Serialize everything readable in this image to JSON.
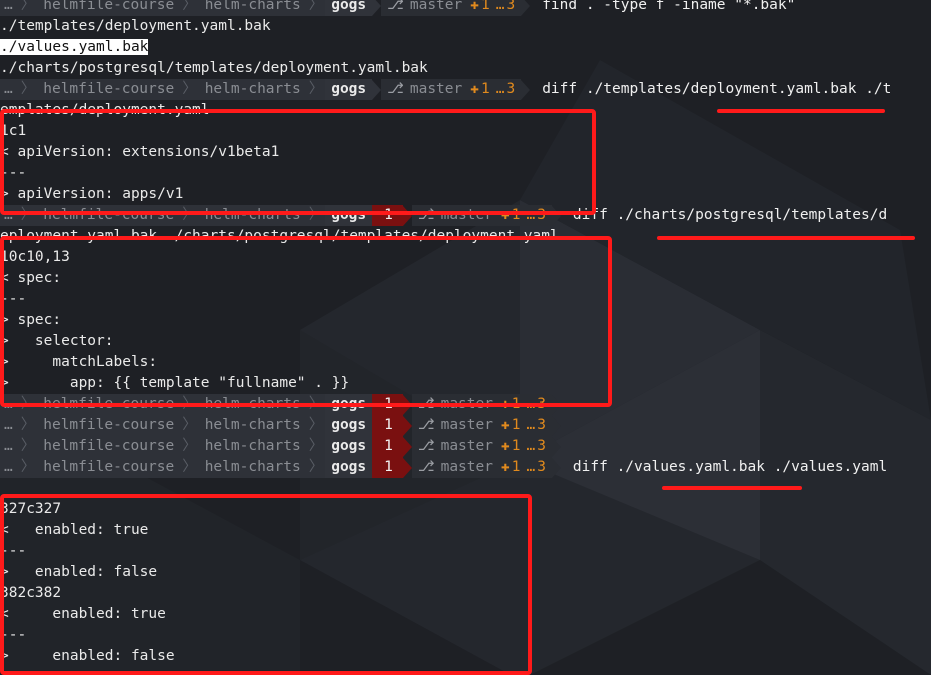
{
  "prompt": {
    "ellipsis": "…",
    "dir1": "helmfile-course",
    "dir2": "helm-charts",
    "dir3": "gogs",
    "branch_icon": "git-branch-icon",
    "branch": "master",
    "plus": "✚",
    "added": "1",
    "more": "…",
    "untracked": "3",
    "exit_code": "1"
  },
  "lines": [
    {
      "type": "prompt",
      "cmd": "find . -type f -iname \"*.bak\""
    },
    {
      "type": "out",
      "text": "./templates/deployment.yaml.bak"
    },
    {
      "type": "out_hl",
      "text": "./values.yaml.bak"
    },
    {
      "type": "out",
      "text": "./charts/postgresql/templates/deployment.yaml.bak"
    },
    {
      "type": "prompt",
      "cmd": "diff ./templates/deployment.yaml.bak ./t"
    },
    {
      "type": "out",
      "text": "emplates/deployment.yaml"
    },
    {
      "type": "out",
      "text": "1c1"
    },
    {
      "type": "out",
      "text": "< apiVersion: extensions/v1beta1"
    },
    {
      "type": "out",
      "text": "---"
    },
    {
      "type": "out",
      "text": "> apiVersion: apps/v1"
    },
    {
      "type": "prompt_err",
      "cmd": "diff ./charts/postgresql/templates/d"
    },
    {
      "type": "out",
      "text": "eployment.yaml.bak ./charts/postgresql/templates/deployment.yaml"
    },
    {
      "type": "out",
      "text": "10c10,13"
    },
    {
      "type": "out",
      "text": "< spec:"
    },
    {
      "type": "out",
      "text": "---"
    },
    {
      "type": "out",
      "text": "> spec:"
    },
    {
      "type": "out",
      "text": ">   selector:"
    },
    {
      "type": "out",
      "text": ">     matchLabels:"
    },
    {
      "type": "out",
      "text": ">       app: {{ template \"fullname\" . }}"
    },
    {
      "type": "prompt_err",
      "cmd": ""
    },
    {
      "type": "prompt_err",
      "cmd": ""
    },
    {
      "type": "prompt_err",
      "cmd": ""
    },
    {
      "type": "prompt_err",
      "cmd": "diff ./values.yaml.bak ./values.yaml"
    },
    {
      "type": "out",
      "text": ""
    },
    {
      "type": "out",
      "text": "327c327"
    },
    {
      "type": "out",
      "text": "<   enabled: true"
    },
    {
      "type": "out",
      "text": "---"
    },
    {
      "type": "out",
      "text": ">   enabled: false"
    },
    {
      "type": "out",
      "text": "382c382"
    },
    {
      "type": "out",
      "text": "<     enabled: true"
    },
    {
      "type": "out",
      "text": "---"
    },
    {
      "type": "out",
      "text": ">     enabled: false"
    }
  ],
  "colors": {
    "background": "#1e2025",
    "annotation": "#ff1a1a",
    "error_badge": "#7a1010",
    "git_accent": "#e08a1e"
  }
}
